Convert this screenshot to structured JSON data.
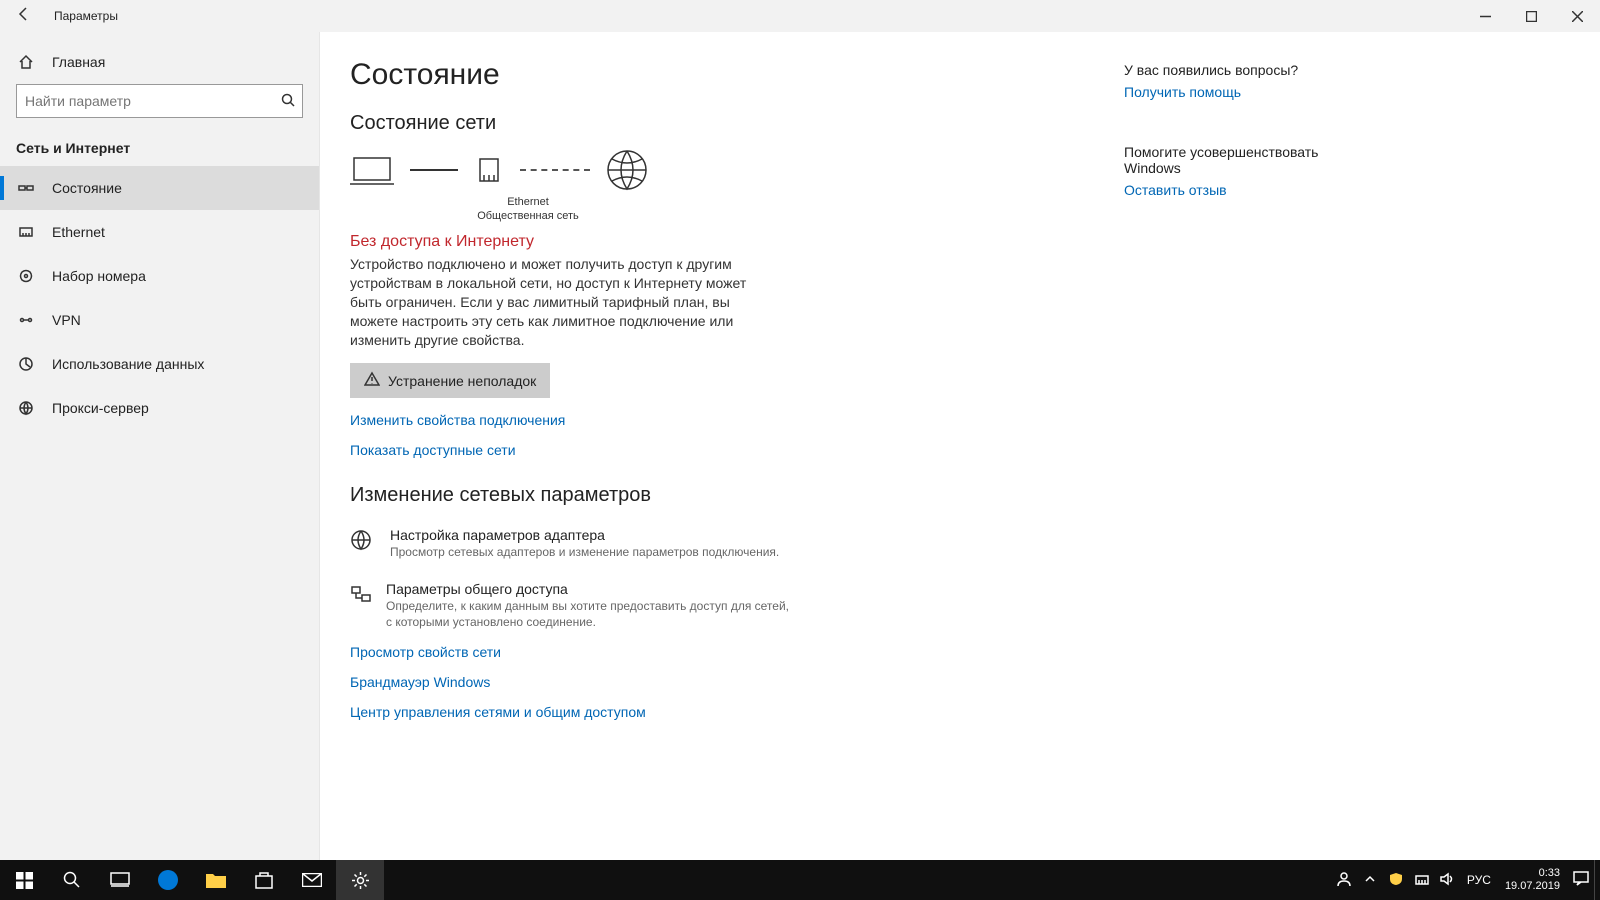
{
  "window": {
    "title": "Параметры",
    "min_tip": "Свернуть",
    "max_tip": "Развернуть",
    "close_tip": "Закрыть"
  },
  "sidebar": {
    "home": "Главная",
    "search_placeholder": "Найти параметр",
    "section": "Сеть и Интернет",
    "items": [
      {
        "icon": "status",
        "label": "Состояние",
        "active": true
      },
      {
        "icon": "ethernet",
        "label": "Ethernet"
      },
      {
        "icon": "dialup",
        "label": "Набор номера"
      },
      {
        "icon": "vpn",
        "label": "VPN"
      },
      {
        "icon": "datausage",
        "label": "Использование данных"
      },
      {
        "icon": "proxy",
        "label": "Прокси-сервер"
      }
    ]
  },
  "main": {
    "page_title": "Состояние",
    "network_status": "Состояние сети",
    "diagram": {
      "adapter": "Ethernet",
      "profile": "Общественная сеть"
    },
    "warning": "Без доступа к Интернету",
    "description": "Устройство подключено и может получить доступ к другим устройствам в локальной сети, но доступ к Интернету может быть ограничен. Если у вас лимитный тарифный план, вы можете настроить эту сеть как лимитное подключение или изменить другие свойства.",
    "troubleshoot": "Устранение неполадок",
    "change_props": "Изменить свойства подключения",
    "show_networks": "Показать доступные сети",
    "change_settings": "Изменение сетевых параметров",
    "adapter_opts": {
      "title": "Настройка параметров адаптера",
      "desc": "Просмотр сетевых адаптеров и изменение параметров подключения."
    },
    "sharing_opts": {
      "title": "Параметры общего доступа",
      "desc": "Определите, к каким данным вы хотите предоставить доступ для сетей, с которыми установлено соединение."
    },
    "view_props": "Просмотр свойств сети",
    "firewall": "Брандмауэр Windows",
    "network_center": "Центр управления сетями и общим доступом"
  },
  "help": {
    "q_title": "У вас появились вопросы?",
    "q_link": "Получить помощь",
    "f_title": "Помогите усовершенствовать Windows",
    "f_link": "Оставить отзыв"
  },
  "taskbar": {
    "lang": "РУС",
    "time": "0:33",
    "date": "19.07.2019"
  }
}
